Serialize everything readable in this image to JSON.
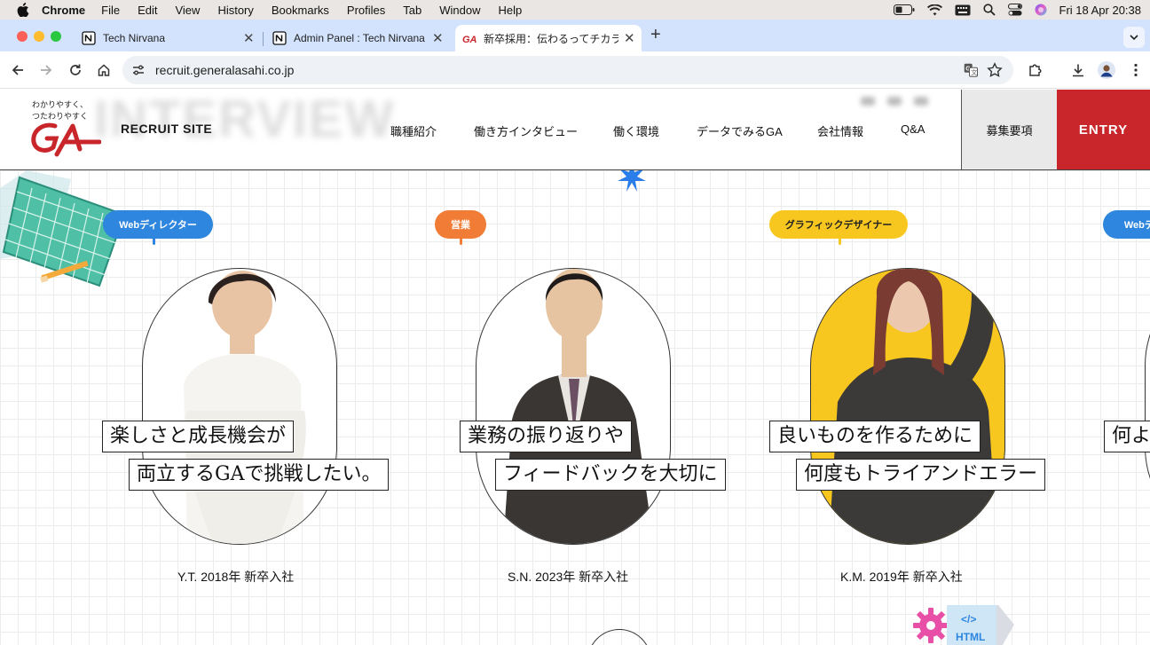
{
  "menubar": {
    "app": "Chrome",
    "items": [
      "File",
      "Edit",
      "View",
      "History",
      "Bookmarks",
      "Profiles",
      "Tab",
      "Window",
      "Help"
    ],
    "clock": "Fri 18 Apr  20:38"
  },
  "tabs": [
    {
      "title": "Tech Nirvana",
      "icon": "notion-icon"
    },
    {
      "title": "Admin Panel : Tech Nirvana",
      "icon": "notion-icon"
    },
    {
      "title": "新卒採用：伝わるってチカラだ",
      "icon": "ga-favicon",
      "active": true
    }
  ],
  "address_bar": {
    "url": "recruit.generalasahi.co.jp"
  },
  "site": {
    "tagline_line1": "わかりやすく、",
    "tagline_line2": "つたわりやすく",
    "recruit_label": "RECRUIT SITE",
    "ghost_word": "INTERVIEW",
    "nav": [
      "職種紹介",
      "働き方インタビュー",
      "働く環境",
      "データでみるGA",
      "会社情報",
      "Q&A"
    ],
    "requirements_button": "募集要項",
    "entry_button": "ENTRY",
    "brand_red": "#c9262b"
  },
  "interviews": [
    {
      "role": "Webディレクター",
      "role_color": "#2e86de",
      "quote_line1": "楽しさと成長機会が",
      "quote_line2": "両立するGAで挑戦したい。",
      "caption": "Y.T.  2018年 新卒入社"
    },
    {
      "role": "営業",
      "role_color": "#f07c35",
      "quote_line1": "業務の振り返りや",
      "quote_line2": "フィードバックを大切に",
      "caption": "S.N.  2023年 新卒入社"
    },
    {
      "role": "グラフィックデザイナー",
      "role_color": "#f8c71f",
      "quote_line1": "良いものを作るために",
      "quote_line2": "何度もトライアンドエラー",
      "caption": "K.M.  2019年 新卒入社"
    },
    {
      "role": "Webディ",
      "role_color": "#2e86de",
      "quote_line1": "何よ"
    }
  ],
  "deco": {
    "html_badge": "</>",
    "html_badge_text": "HTML"
  }
}
